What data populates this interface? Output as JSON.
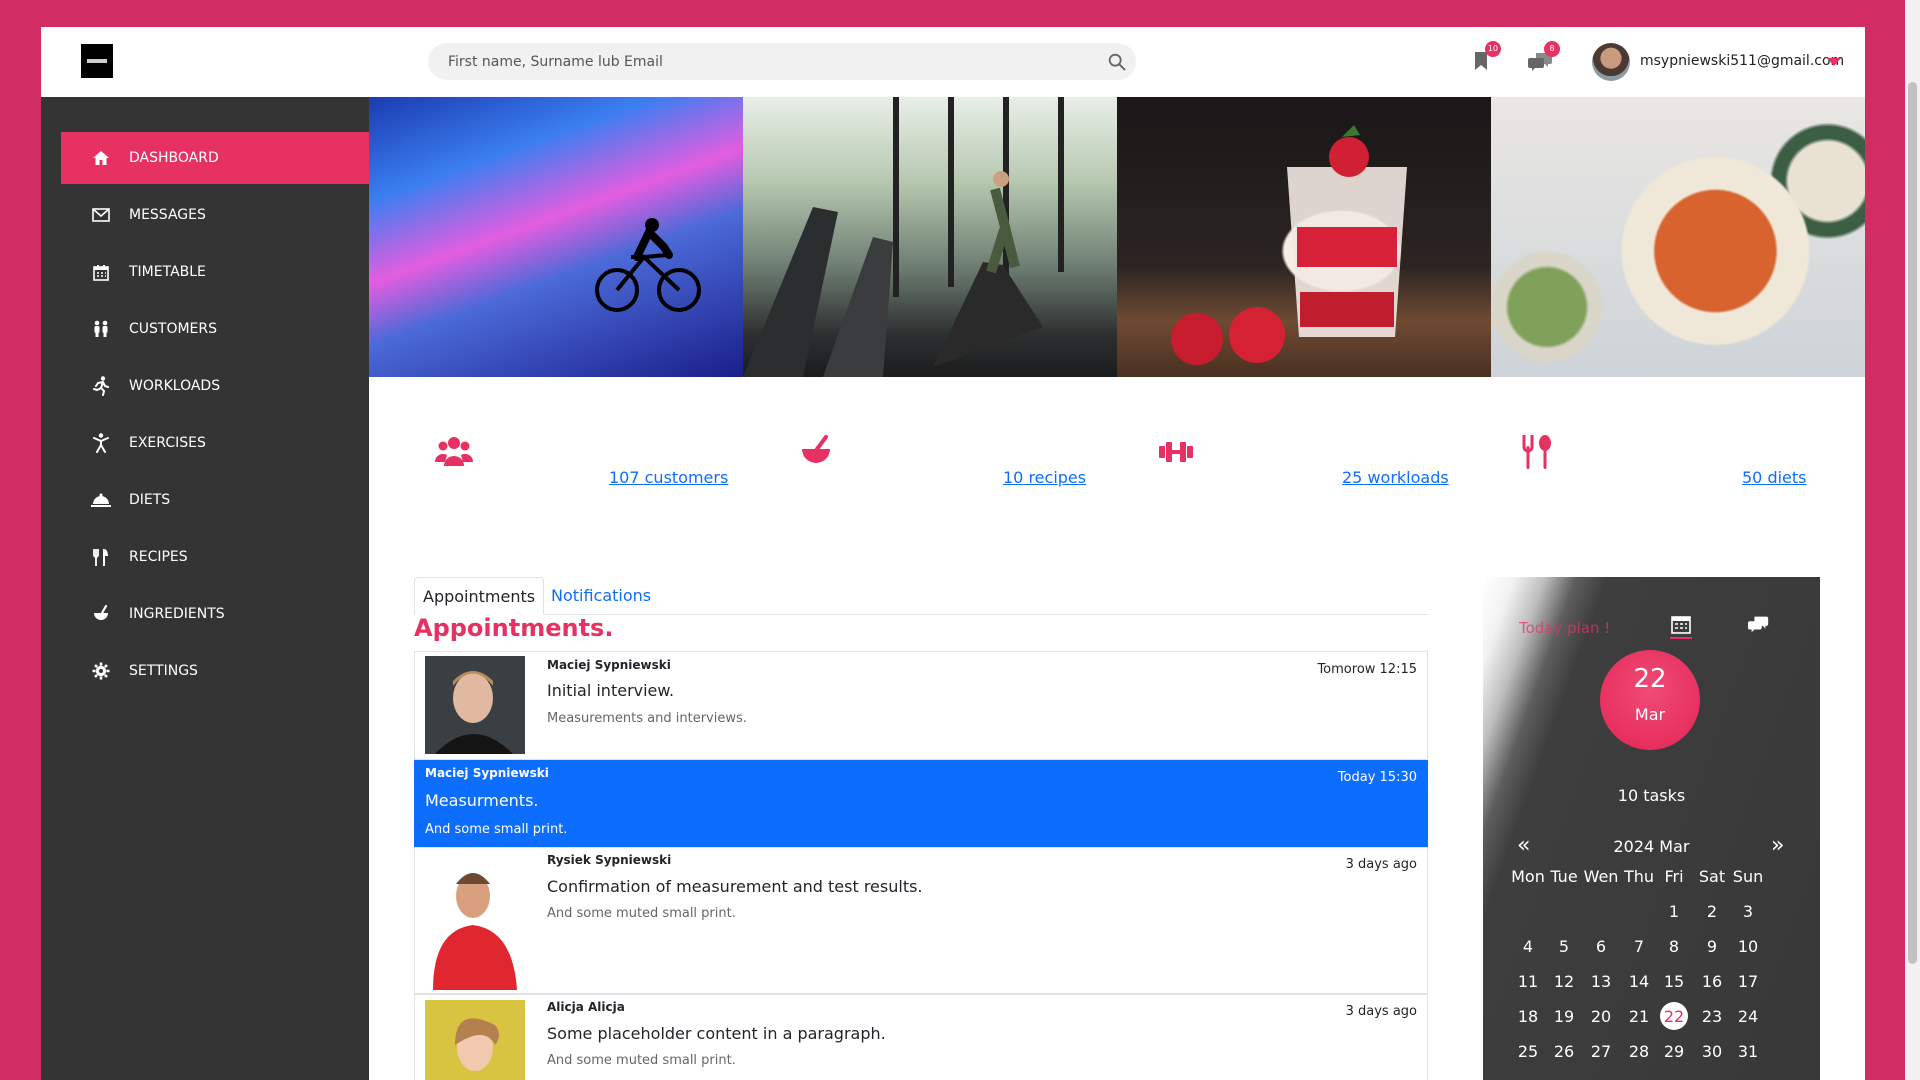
{
  "header": {
    "search_placeholder": "First name, Surname lub Email",
    "bookmarks_count": "10",
    "messages_count": "8",
    "user_email": "msypniewski511@gmail.com"
  },
  "sidebar": {
    "items": [
      {
        "label": "DASHBOARD",
        "icon": "home-icon"
      },
      {
        "label": "MESSAGES",
        "icon": "envelope-icon"
      },
      {
        "label": "TIMETABLE",
        "icon": "calendar-icon"
      },
      {
        "label": "CUSTOMERS",
        "icon": "people-icon"
      },
      {
        "label": "WORKLOADS",
        "icon": "running-icon"
      },
      {
        "label": "EXERCISES",
        "icon": "exercise-icon"
      },
      {
        "label": "DIETS",
        "icon": "cloche-icon"
      },
      {
        "label": "RECIPES",
        "icon": "utensils-icon"
      },
      {
        "label": "INGREDIENTS",
        "icon": "mortar-icon"
      },
      {
        "label": "SETTINGS",
        "icon": "gear-icon"
      }
    ]
  },
  "stats": {
    "customers": "107 customers",
    "recipes": "10 recipes",
    "workloads": "25 workloads",
    "diets": "50 diets"
  },
  "tabs": {
    "appointments": "Appointments",
    "notifications": "Notifications"
  },
  "section_title": "Appointments.",
  "appointments": [
    {
      "name": "Maciej Sypniewski",
      "time": "Tomorow 12:15",
      "heading": "Initial interview.",
      "small": "Measurements and interviews."
    },
    {
      "name": "Maciej Sypniewski",
      "time": "Today 15:30",
      "heading": "Measurments.",
      "small": "And some small print."
    },
    {
      "name": "Rysiek Sypniewski",
      "time": "3 days ago",
      "heading": "Confirmation of measurement and test results.",
      "small": "And some muted small print."
    },
    {
      "name": "Alicja Alicja",
      "time": "3 days ago",
      "heading": "Some placeholder content in a paragraph.",
      "small": "And some muted small print."
    }
  ],
  "calendar": {
    "today_plan": "Today plan !",
    "day": "22",
    "month": "Mar",
    "tasks": "10 tasks",
    "month_year": "2024 Mar",
    "prev": "«",
    "next": "»",
    "weekdays": [
      "Mon",
      "Tue",
      "Wen",
      "Thu",
      "Fri",
      "Sat",
      "Sun"
    ],
    "selected": "22",
    "accent": "#e83163"
  },
  "colors": {
    "accent": "#e83163",
    "sidebar": "#343434",
    "link": "#0d6efd",
    "background": "#d12c63"
  }
}
